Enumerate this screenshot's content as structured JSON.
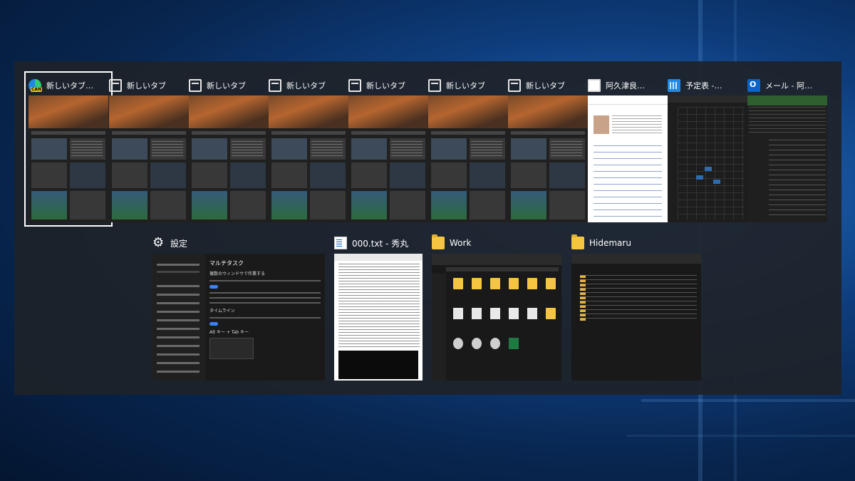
{
  "switcher": {
    "top_row": [
      {
        "title": "新しいタブ…",
        "icon": "edge-can-icon",
        "badge": "CAN",
        "selected": true,
        "thumb": "news"
      },
      {
        "title": "新しいタブ",
        "icon": "tab-icon",
        "thumb": "news"
      },
      {
        "title": "新しいタブ",
        "icon": "tab-icon",
        "thumb": "news"
      },
      {
        "title": "新しいタブ",
        "icon": "tab-icon",
        "thumb": "news"
      },
      {
        "title": "新しいタブ",
        "icon": "tab-icon",
        "thumb": "news"
      },
      {
        "title": "新しいタブ",
        "icon": "tab-icon",
        "thumb": "news"
      },
      {
        "title": "新しいタブ",
        "icon": "tab-icon",
        "thumb": "news"
      },
      {
        "title": "阿久津良…",
        "icon": "person-icon",
        "thumb": "article"
      },
      {
        "title": "予定表 -…",
        "icon": "calendar-icon",
        "thumb": "calendar"
      },
      {
        "title": "メール - 阿…",
        "icon": "outlook-icon",
        "thumb": "mail"
      }
    ],
    "bottom_row": [
      {
        "title": "設定",
        "icon": "gear-icon"
      },
      {
        "title": "000.txt  - 秀丸",
        "icon": "notepad-icon"
      },
      {
        "title": "Work",
        "icon": "folder-icon"
      },
      {
        "title": "Hidemaru",
        "icon": "folder-icon"
      }
    ],
    "settings_preview": {
      "heading": "マルチタスク",
      "subheading": "複数のウィンドウで作業する",
      "section2": "タイムライン",
      "section3": "Alt キー + Tab キー"
    }
  }
}
